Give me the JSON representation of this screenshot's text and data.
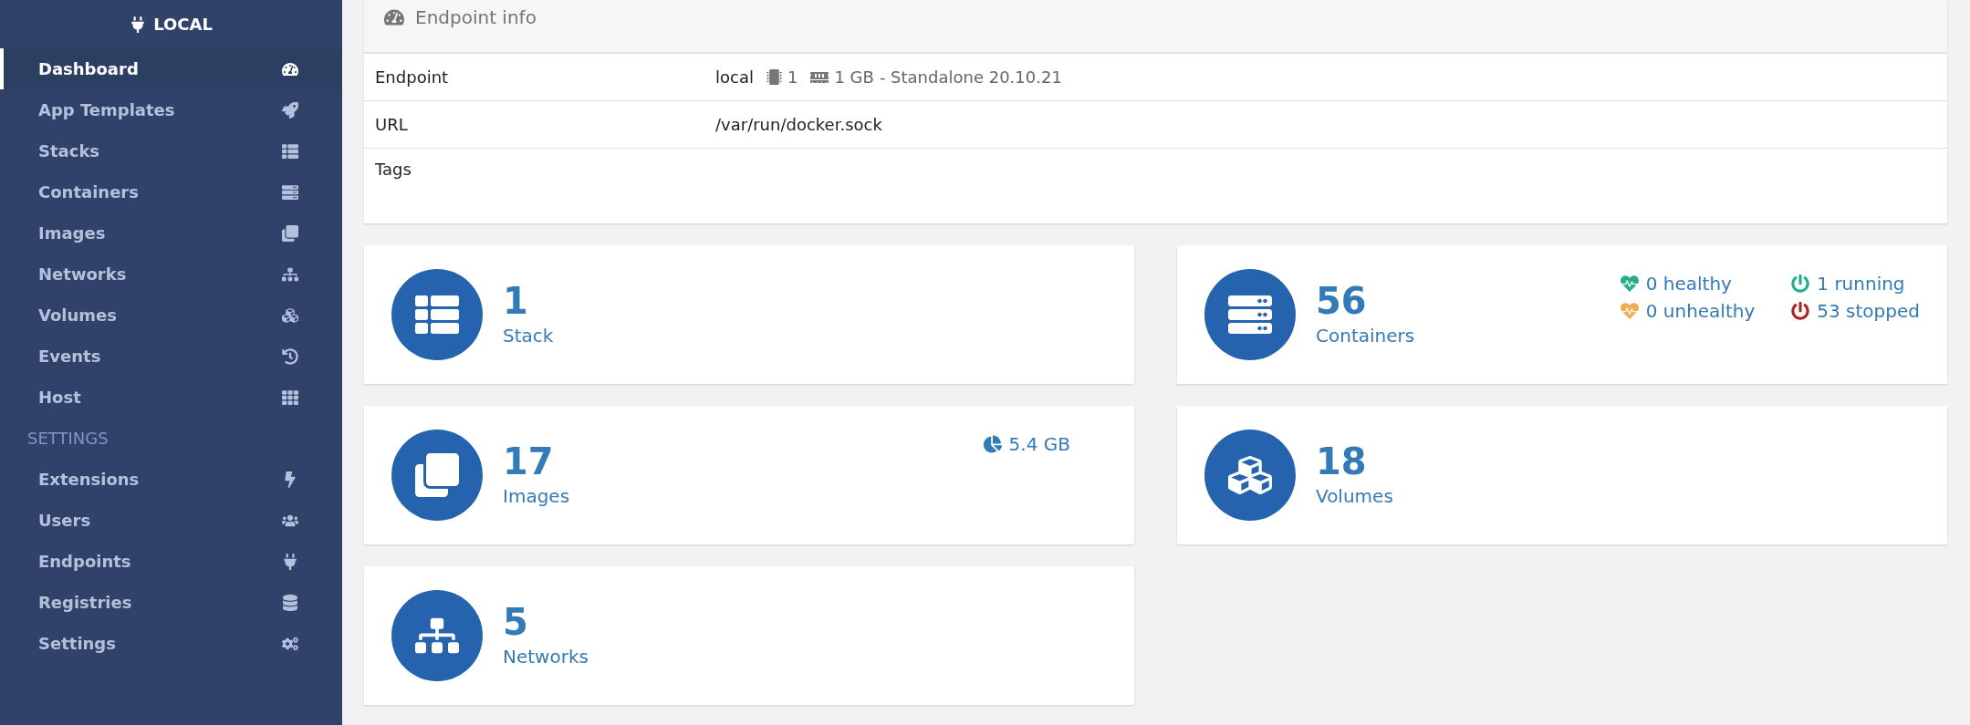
{
  "sidebar": {
    "title": "LOCAL",
    "items": [
      {
        "label": "Dashboard",
        "selected": true
      },
      {
        "label": "App Templates",
        "selected": false
      },
      {
        "label": "Stacks",
        "selected": false
      },
      {
        "label": "Containers",
        "selected": false
      },
      {
        "label": "Images",
        "selected": false
      },
      {
        "label": "Networks",
        "selected": false
      },
      {
        "label": "Volumes",
        "selected": false
      },
      {
        "label": "Events",
        "selected": false
      },
      {
        "label": "Host",
        "selected": false
      }
    ],
    "section": "SETTINGS",
    "settings_items": [
      {
        "label": "Extensions",
        "selected": false
      },
      {
        "label": "Users",
        "selected": false
      },
      {
        "label": "Endpoints",
        "selected": false
      },
      {
        "label": "Registries",
        "selected": false
      },
      {
        "label": "Settings",
        "selected": false
      }
    ]
  },
  "endpoint_info": {
    "title": "Endpoint info",
    "rows": [
      {
        "label": "Endpoint",
        "name": "local",
        "cpu": "1",
        "memory": "1 GB",
        "detail": "- Standalone 20.10.21"
      },
      {
        "label": "URL",
        "value": "/var/run/docker.sock"
      },
      {
        "label": "Tags"
      }
    ]
  },
  "cards": [
    {
      "kind": "stacks",
      "count": "1",
      "label": "Stack"
    },
    {
      "kind": "containers",
      "count": "56",
      "label": "Containers",
      "stats": [
        {
          "kind": "heart",
          "text": "0 healthy",
          "color": "#23ae89"
        },
        {
          "kind": "power",
          "text": "1 running",
          "color": "#23ae89"
        },
        {
          "kind": "heart",
          "text": "0 unhealthy",
          "color": "#f0ad4e"
        },
        {
          "kind": "power",
          "text": "53 stopped",
          "color": "#ae2323"
        }
      ]
    },
    {
      "kind": "images",
      "count": "17",
      "label": "Images",
      "size": "5.4 GB"
    },
    {
      "kind": "volumes",
      "count": "18",
      "label": "Volumes"
    },
    {
      "kind": "networks",
      "count": "5",
      "label": "Networks"
    }
  ]
}
